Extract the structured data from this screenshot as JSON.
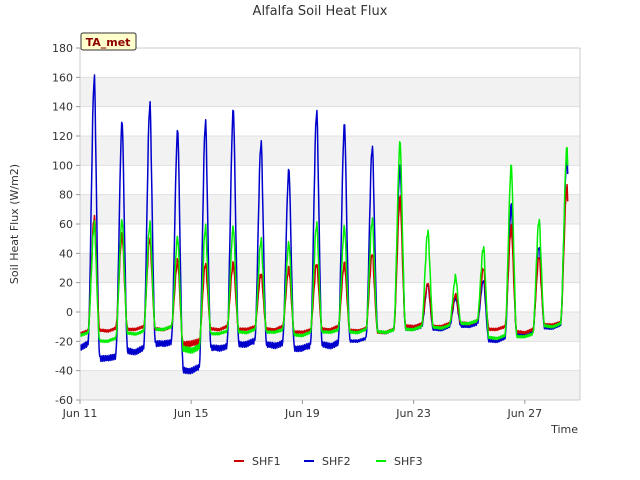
{
  "chart_data": {
    "type": "line",
    "title": "Alfalfa Soil Heat Flux",
    "xlabel": "Time",
    "ylabel": "Soil Heat Flux (W/m2)",
    "ylim": [
      -60,
      180
    ],
    "yticks": [
      -60,
      -40,
      -20,
      0,
      20,
      40,
      60,
      80,
      100,
      120,
      140,
      160,
      180
    ],
    "xlim": [
      "2024-06-11",
      "2024-06-29"
    ],
    "xticks": [
      {
        "date": "2024-06-11",
        "label": "Jun 11"
      },
      {
        "date": "2024-06-15",
        "label": "Jun 15"
      },
      {
        "date": "2024-06-19",
        "label": "Jun 19"
      },
      {
        "date": "2024-06-23",
        "label": "Jun 23"
      },
      {
        "date": "2024-06-27",
        "label": "Jun 27"
      }
    ],
    "grid": "horizontal bands",
    "badge": "TA_met",
    "legend_position": "bottom-center",
    "series": [
      {
        "name": "SHF1",
        "color": "#cc0000",
        "daily_peak": [
          65,
          53,
          50,
          35,
          33,
          33,
          26,
          30,
          33,
          33,
          40,
          78,
          20,
          12,
          30,
          58,
          38,
          85
        ],
        "daily_min": [
          -15,
          -13,
          -12,
          -12,
          -22,
          -12,
          -12,
          -12,
          -14,
          -12,
          -13,
          -14,
          -10,
          -10,
          -8,
          -12,
          -14,
          -9
        ]
      },
      {
        "name": "SHF2",
        "color": "#0000cc",
        "daily_peak": [
          160,
          130,
          142,
          124,
          130,
          138,
          116,
          97,
          137,
          128,
          113,
          100,
          19,
          10,
          22,
          73,
          45,
          106
        ],
        "daily_min": [
          -24,
          -32,
          -27,
          -22,
          -40,
          -25,
          -22,
          -23,
          -25,
          -23,
          -20,
          -14,
          -12,
          -12,
          -10,
          -20,
          -16,
          -11
        ]
      },
      {
        "name": "SHF3",
        "color": "#00ee00",
        "daily_peak": [
          60,
          63,
          60,
          51,
          58,
          58,
          49,
          47,
          60,
          58,
          63,
          116,
          55,
          24,
          44,
          100,
          63,
          112
        ],
        "daily_min": [
          -16,
          -20,
          -15,
          -12,
          -26,
          -15,
          -14,
          -14,
          -16,
          -14,
          -14,
          -14,
          -12,
          -11,
          -8,
          -18,
          -17,
          -10
        ]
      }
    ]
  }
}
